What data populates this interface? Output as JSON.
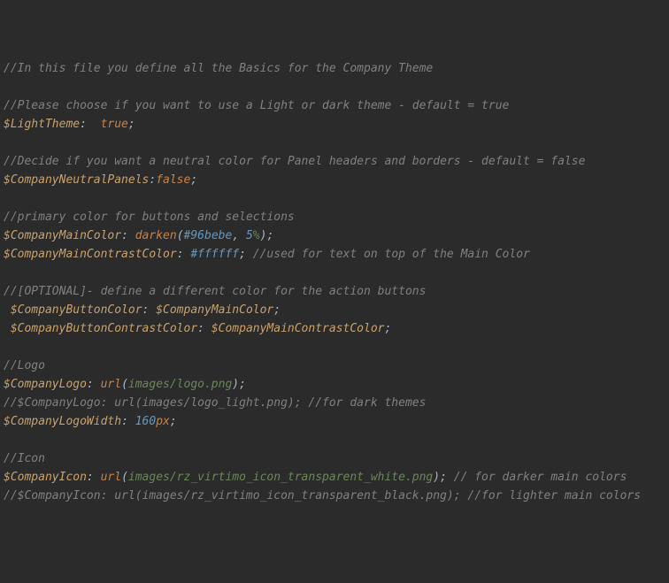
{
  "lines": {
    "l1": "//In this file you define all the Basics for the Company Theme",
    "l3": "//Please choose if you want to use a Light or dark theme - default = true",
    "l4v": "$LightTheme",
    "l4p1": ":  ",
    "l4val": "true",
    "l4s": ";",
    "l6": "//Decide if you want a neutral color for Panel headers and borders - default = false",
    "l7v": "$CompanyNeutralPanels",
    "l7p1": ":",
    "l7val": "false",
    "l7s": ";",
    "l9": "//primary color for buttons and selections",
    "l10v": "$CompanyMainColor",
    "l10p1": ": ",
    "l10fn": "darken",
    "l10p2": "(",
    "l10hex": "#96bebe",
    "l10c": ", ",
    "l10n": "5",
    "l10u": "%",
    "l10p3": ")",
    "l10s": ";",
    "l11v": "$CompanyMainContrastColor",
    "l11p1": ": ",
    "l11hex": "#ffffff",
    "l11s": "; ",
    "l11c": "//used for text on top of the Main Color",
    "l13": "//[OPTIONAL]- define a different color for the action buttons",
    "l14sp": " ",
    "l14v": "$CompanyButtonColor",
    "l14p1": ": ",
    "l14v2": "$CompanyMainColor",
    "l14s": ";",
    "l15sp": " ",
    "l15v": "$CompanyButtonContrastColor",
    "l15p1": ": ",
    "l15v2": "$CompanyMainContrastColor",
    "l15s": ";",
    "l17": "//Logo",
    "l18v": "$CompanyLogo",
    "l18p1": ": ",
    "l18fn": "url",
    "l18p2": "(",
    "l18str": "images/logo.png",
    "l18p3": ")",
    "l18s": ";",
    "l19": "//$CompanyLogo: url(images/logo_light.png); //for dark themes",
    "l20v": "$CompanyLogoWidth",
    "l20p1": ": ",
    "l20n": "160",
    "l20u": "px",
    "l20s": ";",
    "l22": "//Icon",
    "l23v": "$CompanyIcon",
    "l23p1": ": ",
    "l23fn": "url",
    "l23p2": "(",
    "l23str": "images/rz_virtimo_icon_transparent_white.png",
    "l23p3": ")",
    "l23s": "; ",
    "l23c": "// for darker main colors",
    "l24": "//$CompanyIcon: url(images/rz_virtimo_icon_transparent_black.png); //for lighter main colors"
  }
}
